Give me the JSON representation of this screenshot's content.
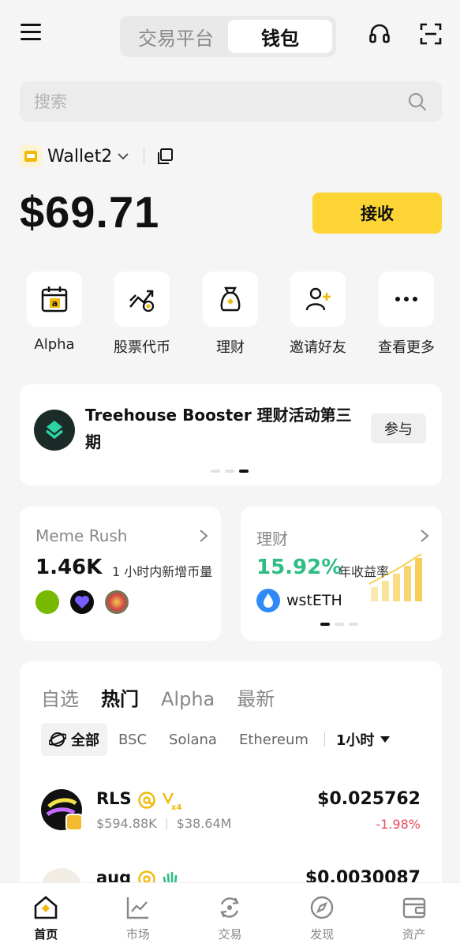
{
  "header": {
    "tabs": [
      {
        "label": "交易平台",
        "active": false
      },
      {
        "label": "钱包",
        "active": true
      }
    ]
  },
  "search": {
    "placeholder": "搜索"
  },
  "wallet": {
    "name": "Wallet2",
    "balance": "$69.71",
    "receive_label": "接收"
  },
  "quick_actions": [
    {
      "label": "Alpha",
      "icon": "alpha-calendar-icon"
    },
    {
      "label": "股票代币",
      "icon": "stock-token-icon"
    },
    {
      "label": "理财",
      "icon": "earn-bag-icon"
    },
    {
      "label": "邀请好友",
      "icon": "invite-user-icon"
    },
    {
      "label": "查看更多",
      "icon": "more-dots-icon"
    }
  ],
  "promo": {
    "title": "Treehouse Booster 理财活动第三期",
    "button": "参与",
    "active_dot": 2
  },
  "meme_card": {
    "title": "Meme Rush",
    "value": "1.46K",
    "caption": "1 小时内新增币量"
  },
  "earn_card": {
    "title": "理财",
    "apy": "15.92%",
    "caption": "年收益率",
    "token": "wstETH"
  },
  "market": {
    "tabs": [
      {
        "label": "自选",
        "active": false
      },
      {
        "label": "热门",
        "active": true
      },
      {
        "label": "Alpha",
        "active": false
      },
      {
        "label": "最新",
        "active": false
      }
    ],
    "chips": [
      {
        "label": "全部",
        "active": true
      },
      {
        "label": "BSC",
        "active": false
      },
      {
        "label": "Solana",
        "active": false
      },
      {
        "label": "Ethereum",
        "active": false
      }
    ],
    "timeframe": "1小时",
    "tokens": [
      {
        "symbol": "RLS",
        "market_cap": "$594.88K",
        "volume": "$38.64M",
        "price": "$0.025762",
        "change": "-1.98%"
      },
      {
        "symbol": "aug",
        "market_cap": "",
        "volume": "",
        "price": "$0.0030087",
        "change": ""
      }
    ]
  },
  "tabbar": [
    {
      "label": "首页",
      "icon": "home-icon",
      "active": true
    },
    {
      "label": "市场",
      "icon": "market-chart-icon",
      "active": false
    },
    {
      "label": "交易",
      "icon": "trade-swap-icon",
      "active": false
    },
    {
      "label": "发现",
      "icon": "discover-compass-icon",
      "active": false
    },
    {
      "label": "资产",
      "icon": "assets-wallet-icon",
      "active": false
    }
  ],
  "colors": {
    "accent": "#fcd535",
    "positive": "#2ebd85",
    "negative": "#e74c5f"
  }
}
